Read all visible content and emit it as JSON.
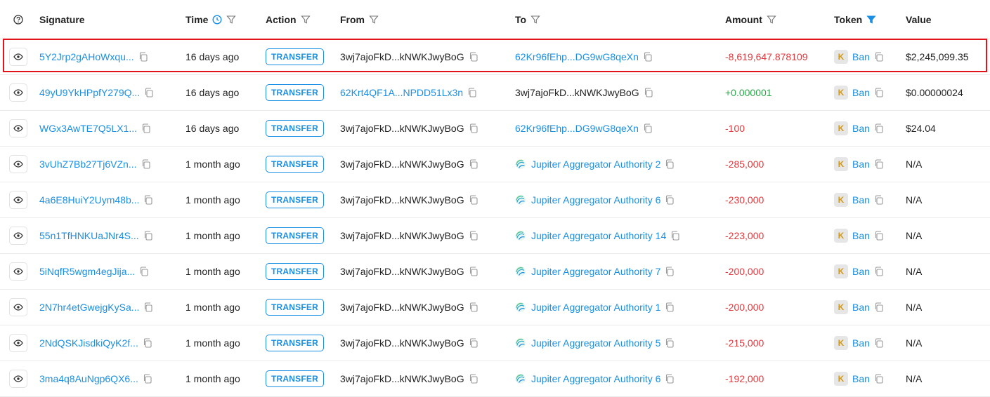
{
  "header": {
    "signature": "Signature",
    "time": "Time",
    "action": "Action",
    "from": "From",
    "to": "To",
    "amount": "Amount",
    "token": "Token",
    "value": "Value"
  },
  "colors": {
    "link": "#1a8fe3",
    "negative": "#e0393e",
    "positive": "#2aa84a",
    "highlight": "#e0141a"
  },
  "rows": [
    {
      "signature": "5Y2Jrp2gAHoWxqu...",
      "time": "16 days ago",
      "action": "TRANSFER",
      "from": "3wj7ajoFkD...kNWKJwyBoG",
      "to": "62Kr96fEhp...DG9wG8qeXn",
      "amount": "-8,619,647.878109",
      "token": "Ban",
      "value": "$2,245,099.35"
    },
    {
      "signature": "49yU9YkHPpfY279Q...",
      "time": "16 days ago",
      "action": "TRANSFER",
      "from": "62Krt4QF1A...NPDD51Lx3n",
      "to": "3wj7ajoFkD...kNWKJwyBoG",
      "amount": "+0.000001",
      "token": "Ban",
      "value": "$0.00000024"
    },
    {
      "signature": "WGx3AwTE7Q5LX1...",
      "time": "16 days ago",
      "action": "TRANSFER",
      "from": "3wj7ajoFkD...kNWKJwyBoG",
      "to": "62Kr96fEhp...DG9wG8qeXn",
      "amount": "-100",
      "token": "Ban",
      "value": "$24.04"
    },
    {
      "signature": "3vUhZ7Bb27Tj6VZn...",
      "time": "1 month ago",
      "action": "TRANSFER",
      "from": "3wj7ajoFkD...kNWKJwyBoG",
      "to": "Jupiter Aggregator Authority 2",
      "amount": "-285,000",
      "token": "Ban",
      "value": "N/A"
    },
    {
      "signature": "4a6E8HuiY2Uym48b...",
      "time": "1 month ago",
      "action": "TRANSFER",
      "from": "3wj7ajoFkD...kNWKJwyBoG",
      "to": "Jupiter Aggregator Authority 6",
      "amount": "-230,000",
      "token": "Ban",
      "value": "N/A"
    },
    {
      "signature": "55n1TfHNKUaJNr4S...",
      "time": "1 month ago",
      "action": "TRANSFER",
      "from": "3wj7ajoFkD...kNWKJwyBoG",
      "to": "Jupiter Aggregator Authority 14",
      "amount": "-223,000",
      "token": "Ban",
      "value": "N/A"
    },
    {
      "signature": "5iNqfR5wgm4egJija...",
      "time": "1 month ago",
      "action": "TRANSFER",
      "from": "3wj7ajoFkD...kNWKJwyBoG",
      "to": "Jupiter Aggregator Authority 7",
      "amount": "-200,000",
      "token": "Ban",
      "value": "N/A"
    },
    {
      "signature": "2N7hr4etGwejgKySa...",
      "time": "1 month ago",
      "action": "TRANSFER",
      "from": "3wj7ajoFkD...kNWKJwyBoG",
      "to": "Jupiter Aggregator Authority 1",
      "amount": "-200,000",
      "token": "Ban",
      "value": "N/A"
    },
    {
      "signature": "2NdQSKJisdkiQyK2f...",
      "time": "1 month ago",
      "action": "TRANSFER",
      "from": "3wj7ajoFkD...kNWKJwyBoG",
      "to": "Jupiter Aggregator Authority 5",
      "amount": "-215,000",
      "token": "Ban",
      "value": "N/A"
    },
    {
      "signature": "3ma4q8AuNgp6QX6...",
      "time": "1 month ago",
      "action": "TRANSFER",
      "from": "3wj7ajoFkD...kNWKJwyBoG",
      "to": "Jupiter Aggregator Authority 6",
      "amount": "-192,000",
      "token": "Ban",
      "value": "N/A"
    }
  ]
}
